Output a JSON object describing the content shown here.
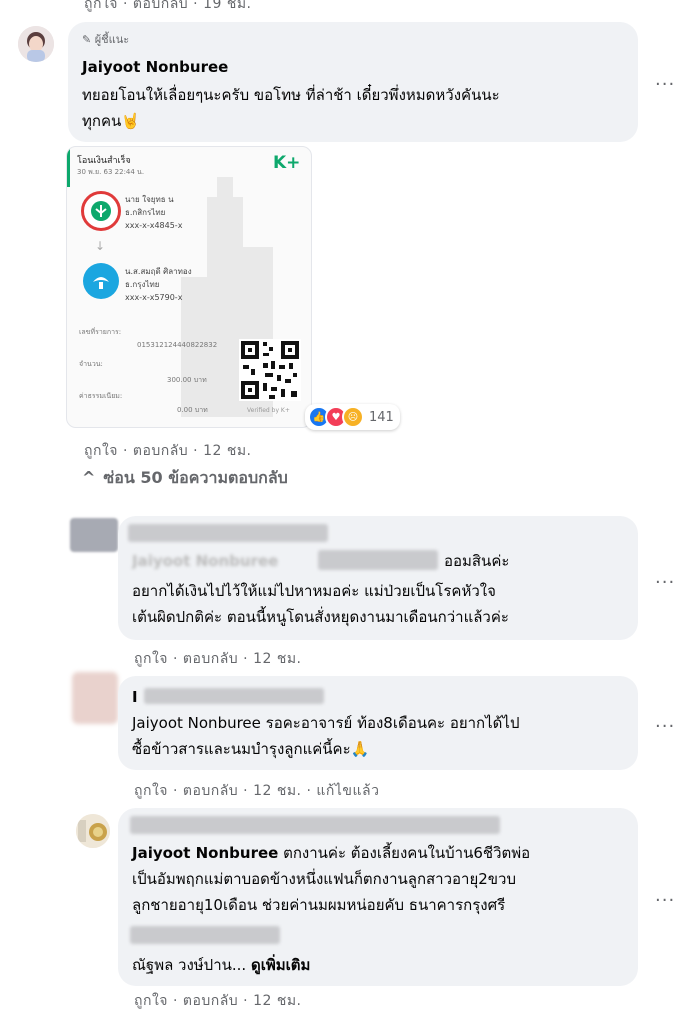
{
  "top_actions": {
    "like": "ถูกใจ",
    "reply": "ตอบกลับ",
    "time": "19 ชม."
  },
  "author_comment": {
    "badge": "ผู้ชี้แนะ",
    "name": "Jaiyoot Nonburee",
    "line1": "ทยอยโอนให้เลื่อยๆนะครับ ขอโทษ ที่ล่าช้า เดี๋ยวพึ่งหมดหวังคันนะ",
    "line2": "ทุกคน",
    "emoji": "🤘",
    "more": "···"
  },
  "receipt": {
    "header": "โอนเงินสำเร็จ",
    "date": "30 พ.ย. 63  22:44 น.",
    "logo": "K+",
    "from_name": "นาย ใจยุทธ น",
    "from_sub": "ธ.กสิกรไทย",
    "from_acct": "xxx-x-x4845-x",
    "arrow": "↓",
    "to_name": "น.ส.สมฤดี ศิลาทอง",
    "to_sub": "ธ.กรุงไทย",
    "to_acct": "xxx-x-x5790-x",
    "ref_label": "เลขที่รายการ:",
    "ref_value": "015312124440822832",
    "amount_label": "จำนวน:",
    "amount_value": "300.00 บาท",
    "fee_label": "ค่าธรรมเนียม:",
    "fee_value": "0.00 บาท",
    "verify": "Verified by K+"
  },
  "reactions": {
    "count": "141"
  },
  "author_actions": {
    "like": "ถูกใจ",
    "reply": "ตอบกลับ",
    "time": "12 ชม."
  },
  "hide_replies": {
    "icon": "^",
    "label": "ซ่อน 50 ข้อความตอบกลับ"
  },
  "replies": [
    {
      "tag_prefix": "Jaiyoot Nonburee",
      "line1_suffix": "ออมสินค่ะ",
      "line2": "อยากได้เงินไปไว้ให้แม่ไปหาหมอค่ะ แม่ป่วยเป็นโรคหัวใจ",
      "line3": "เต้นผิดปกติค่ะ ตอนนี้หนูโดนสั่งหยุดงานมาเดือนกว่าแล้วค่ะ",
      "like": "ถูกใจ",
      "reply": "ตอบกลับ",
      "time": "12 ชม.",
      "more": "···"
    },
    {
      "name_initial": "I",
      "line1": "Jaiyoot Nonburee รอคะอาจารย์ ท้อง8เดือนคะ อยากได้ไป",
      "line2": "ซื้อข้าวสารและนมบำรุงลูกแค่นี้คะ",
      "emoji": "🙏",
      "like": "ถูกใจ",
      "reply": "ตอบกลับ",
      "time": "12 ชม.",
      "edited": "แก้ไขแล้ว",
      "more": "···"
    },
    {
      "tag": "Jaiyoot Nonburee",
      "line1": "ตกงานค่ะ ต้องเลี้ยงคนในบ้าน6ชีวิตพ่อ",
      "line2": "เป็นอัมพฤกแม่ตาบอดข้างหนึ่งแฟนก็ตกงานลูกสาวอายุ2ขวบ",
      "line3": "ลูกชายอายุ10เดือน ช่วยค่านมผมหน่อยคับ ธนาคารกรุงศรี",
      "mention": "ณัฐพล วงษ์ปาน...",
      "see_more": "ดูเพิ่มเติม",
      "like": "ถูกใจ",
      "reply": "ตอบกลับ",
      "time": "12 ชม.",
      "more": "···"
    }
  ]
}
